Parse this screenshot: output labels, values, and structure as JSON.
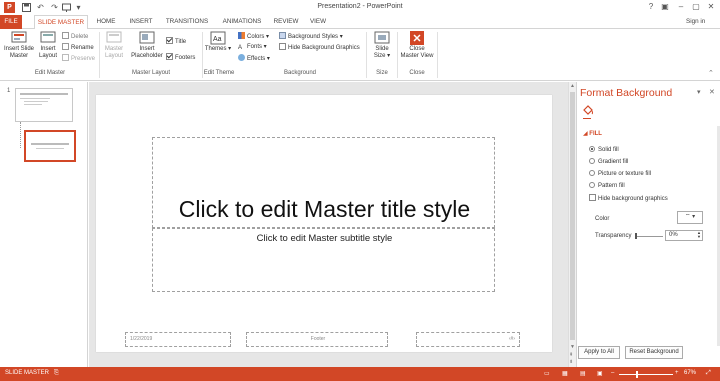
{
  "window": {
    "title": "Presentation2 - PowerPoint",
    "help": "?",
    "sign_in": "Sign in"
  },
  "tabs": [
    "FILE",
    "SLIDE MASTER",
    "HOME",
    "INSERT",
    "TRANSITIONS",
    "ANIMATIONS",
    "REVIEW",
    "VIEW"
  ],
  "ribbon": {
    "edit_master": {
      "label": "Edit Master",
      "insert_slide_master": [
        "Insert Slide",
        "Master"
      ],
      "insert_layout": [
        "Insert",
        "Layout"
      ],
      "delete": "Delete",
      "rename": "Rename",
      "preserve": "Preserve"
    },
    "master_layout": {
      "label": "Master Layout",
      "master_layout": [
        "Master",
        "Layout"
      ],
      "insert_placeholder": [
        "Insert",
        "Placeholder"
      ],
      "title": "Title",
      "footers": "Footers"
    },
    "edit_theme": {
      "label": "Edit Theme",
      "themes": "Themes",
      "colors": "Colors",
      "fonts": "Fonts",
      "effects": "Effects"
    },
    "background": {
      "label": "Background",
      "background_styles": "Background Styles",
      "hide_background_graphics": "Hide Background Graphics"
    },
    "size": {
      "label": "Size",
      "slide_size": [
        "Slide",
        "Size"
      ]
    },
    "close": {
      "label": "Close",
      "close_master_view": [
        "Close",
        "Master View"
      ]
    }
  },
  "thumbnails": {
    "number": "1"
  },
  "slide": {
    "title_placeholder": "Click to edit Master title style",
    "subtitle_placeholder": "Click to edit Master subtitle style",
    "date": "1/22/2019",
    "footer": "Footer",
    "slide_number": "‹#›"
  },
  "format_background": {
    "title": "Format Background",
    "section": "FILL",
    "options": [
      "Solid fill",
      "Gradient fill",
      "Picture or texture fill",
      "Pattern fill"
    ],
    "selected_option": "Solid fill",
    "hide_background_graphics": "Hide background graphics",
    "color_label": "Color",
    "transparency_label": "Transparency",
    "transparency_value": "0%",
    "apply_to_all": "Apply to All",
    "reset_background": "Reset Background"
  },
  "status": {
    "view": "SLIDE MASTER",
    "zoom": "67%"
  },
  "colors": {
    "accent": "#d24726",
    "statusbar": "#d24726"
  },
  "icons": {
    "app": "powerpoint-logo-icon",
    "save": "save-icon",
    "undo": "undo-icon",
    "redo": "redo-icon",
    "start_from_beginning": "start-slideshow-icon",
    "customize_qat": "customize-icon",
    "minimize": "minimize-icon",
    "restore": "restore-icon",
    "close": "close-icon",
    "fill": "paint-bucket-icon"
  }
}
